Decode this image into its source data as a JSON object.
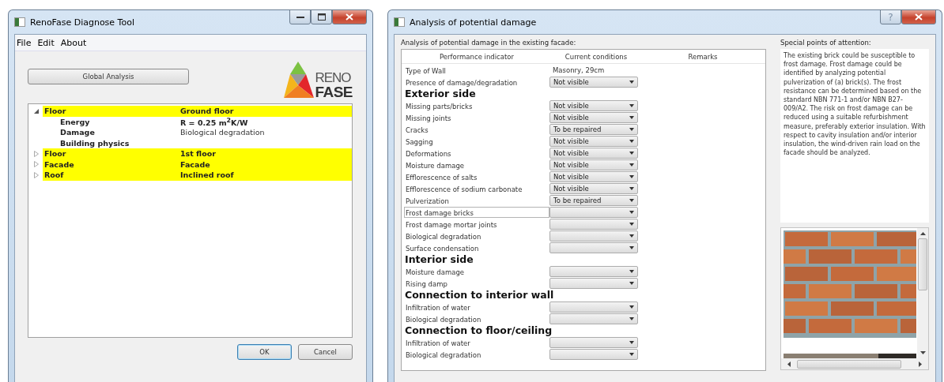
{
  "left_window": {
    "title": "RenoFase Diagnose Tool",
    "menu": [
      "File",
      "Edit",
      "About"
    ],
    "global_button": "Global Analysis",
    "logo": {
      "top": "RENO",
      "bottom": "FASE"
    },
    "tree": [
      {
        "name": "Floor",
        "value": "Ground floor",
        "expanded": true,
        "children": [
          {
            "name": "Energy",
            "value": "R = 0.25 m$^{2}$K/W",
            "emphasis": true
          },
          {
            "name": "Damage",
            "value": "Biological degradation",
            "emphasis": false
          },
          {
            "name": "Building physics"
          }
        ]
      },
      {
        "name": "Floor",
        "value": "1st floor",
        "expanded": false
      },
      {
        "name": "Facade",
        "value": "Facade",
        "expanded": false
      },
      {
        "name": "Roof",
        "value": "Inclined roof",
        "expanded": false
      }
    ],
    "buttons": [
      {
        "label": "OK",
        "default": true
      },
      {
        "label": "Cancel",
        "default": false
      }
    ]
  },
  "right_window": {
    "title": "Analysis of potential damage",
    "help_button": "?",
    "caption": "Analysis of potential damage in the existing facade:",
    "table": {
      "columns": [
        "Performance indicator",
        "Current conditions",
        "Remarks"
      ],
      "rows": [
        {
          "kind": "text",
          "indicator": "Type of Wall",
          "condition": "Masonry, 29cm",
          "selected": false
        },
        {
          "kind": "select",
          "indicator": "Presence of damage/degradation",
          "condition": "Not visible",
          "selected": false
        },
        {
          "kind": "heading",
          "indicator": "Exterior side",
          "selected": false
        },
        {
          "kind": "select",
          "indicator": "Missing parts/bricks",
          "condition": "Not visible",
          "selected": false
        },
        {
          "kind": "select",
          "indicator": "Missing joints",
          "condition": "Not visible",
          "selected": false
        },
        {
          "kind": "select",
          "indicator": "Cracks",
          "condition": "To be repaired",
          "selected": false
        },
        {
          "kind": "select",
          "indicator": "Sagging",
          "condition": "Not visible",
          "selected": false
        },
        {
          "kind": "select",
          "indicator": "Deformations",
          "condition": "Not visible",
          "selected": false
        },
        {
          "kind": "select",
          "indicator": "Moisture damage",
          "condition": "Not visible",
          "selected": false
        },
        {
          "kind": "select",
          "indicator": "Efflorescence of salts",
          "condition": "Not visible",
          "selected": false
        },
        {
          "kind": "select",
          "indicator": "Efflorescence of sodium carbonate",
          "condition": "Not visible",
          "selected": false
        },
        {
          "kind": "select",
          "indicator": "Pulverization",
          "condition": "To be repaired",
          "selected": false
        },
        {
          "kind": "select",
          "indicator": "Frost damage bricks",
          "selected": true
        },
        {
          "kind": "select",
          "indicator": "Frost damage mortar joints",
          "selected": false
        },
        {
          "kind": "select",
          "indicator": "Biological degradation",
          "selected": false
        },
        {
          "kind": "select",
          "indicator": "Surface condensation",
          "selected": false
        },
        {
          "kind": "heading",
          "indicator": "Interior side",
          "selected": false
        },
        {
          "kind": "select",
          "indicator": "Moisture damage",
          "selected": false
        },
        {
          "kind": "select",
          "indicator": "Rising damp",
          "selected": false
        },
        {
          "kind": "heading",
          "indicator": "Connection to interior wall",
          "selected": false
        },
        {
          "kind": "select",
          "indicator": "Infiltration of water",
          "selected": false
        },
        {
          "kind": "select",
          "indicator": "Biological degradation",
          "selected": false
        },
        {
          "kind": "heading",
          "indicator": "Connection to floor/ceiling",
          "selected": false
        },
        {
          "kind": "select",
          "indicator": "Infiltration of water",
          "selected": false
        },
        {
          "kind": "select",
          "indicator": "Biological degradation",
          "selected": false
        }
      ]
    },
    "attention": {
      "label": "Special points of attention:",
      "text": "The existing brick could be susceptible to frost damage. Frost damage could be identified by analyzing potential pulverization of (a) brick(s). The frost resistance can be determined based on the standard NBN 771-1 and/or NBN B27-009/A2. The risk on frost damage can be reduced using a suitable refurbishment measure, preferably exterior insulation. With respect to cavity insulation and/or interior insulation, the wind-driven rain load on the facade should be analyzed."
    }
  }
}
